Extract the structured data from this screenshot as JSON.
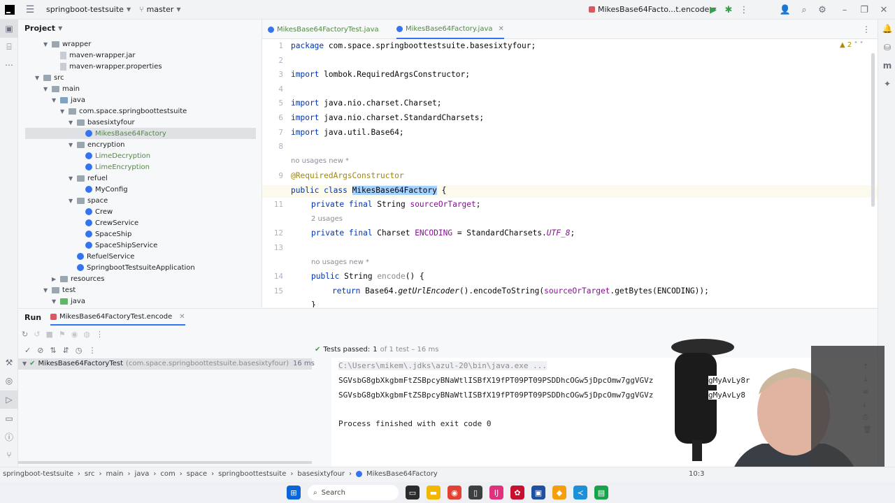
{
  "titlebar": {
    "project_name": "springboot-testsuite",
    "branch": "master",
    "run_config": "MikesBase64Facto...t.encode"
  },
  "project_panel": {
    "title": "Project",
    "items": [
      {
        "label": "wrapper",
        "kind": "folder"
      },
      {
        "label": "maven-wrapper.jar",
        "kind": "file"
      },
      {
        "label": "maven-wrapper.properties",
        "kind": "file"
      },
      {
        "label": "src",
        "kind": "folder"
      },
      {
        "label": "main",
        "kind": "folder"
      },
      {
        "label": "java",
        "kind": "folder"
      },
      {
        "label": "com.space.springboottestsuite",
        "kind": "package"
      },
      {
        "label": "basesixtyfour",
        "kind": "package"
      },
      {
        "label": "MikesBase64Factory",
        "kind": "class"
      },
      {
        "label": "encryption",
        "kind": "package"
      },
      {
        "label": "LimeDecryption",
        "kind": "class"
      },
      {
        "label": "LimeEncryption",
        "kind": "class"
      },
      {
        "label": "refuel",
        "kind": "package"
      },
      {
        "label": "MyConfig",
        "kind": "class"
      },
      {
        "label": "space",
        "kind": "package"
      },
      {
        "label": "Crew",
        "kind": "class"
      },
      {
        "label": "CrewService",
        "kind": "class"
      },
      {
        "label": "SpaceShip",
        "kind": "class"
      },
      {
        "label": "SpaceShipService",
        "kind": "class"
      },
      {
        "label": "RefuelService",
        "kind": "class"
      },
      {
        "label": "SpringbootTestsuiteApplication",
        "kind": "class"
      },
      {
        "label": "resources",
        "kind": "folder"
      },
      {
        "label": "test",
        "kind": "folder"
      },
      {
        "label": "java",
        "kind": "folder"
      }
    ]
  },
  "tabs": [
    {
      "label": "MikesBase64FactoryTest.java"
    },
    {
      "label": "MikesBase64Factory.java"
    }
  ],
  "editor": {
    "warnings": "2",
    "line_numbers": [
      "1",
      "2",
      "3",
      "4",
      "5",
      "6",
      "7",
      "8",
      "9",
      "10",
      "11",
      "12",
      "13",
      "14",
      "15"
    ],
    "line1_pkg": "package",
    "line1_name": " com.space.springboottestsuite.basesixtyfour;",
    "line3_import": "import",
    "line3_name": " lombok.RequiredArgsConstructor;",
    "line5": " java.nio.charset.Charset;",
    "line6": " java.nio.charset.StandardCharsets;",
    "line7": " java.util.Base64;",
    "hint_class": "no usages  new *",
    "annotation": "@RequiredArgsConstructor",
    "class_kw": "public class",
    "class_name": "MikesBase64Factory",
    "class_brace": " {",
    "l11_kw": "private final",
    "l11_type": " String ",
    "l11_field": "sourceOrTarget",
    "l11_end": ";",
    "hint_field": "2 usages",
    "l12_type": " Charset ",
    "l12_field": "ENCODING",
    "l12_mid": " = StandardCharsets.",
    "l12_const": "UTF_8",
    "hint_method": "no usages  new *",
    "l14_kw": "public",
    "l14_type": " String ",
    "l14_name": "encode",
    "l14_end": "() {",
    "l15_return": "return",
    "l15_a": " Base64.",
    "l15_b": "getUrlEncoder",
    "l15_c": "().encodeToString(",
    "l15_d": "sourceOrTarget",
    "l15_e": ".getBytes(ENCODING));",
    "l16": "}"
  },
  "run": {
    "title": "Run",
    "config_tab": "MikesBase64FactoryTest.encode",
    "tests_passed_label": "Tests passed:",
    "tests_passed_count": "1",
    "tests_passed_rest": "of 1 test – 16 ms",
    "test_name": "MikesBase64FactoryTest",
    "test_package": "(com.space.springboottestsuite.basesixtyfour)",
    "test_time": "16 ms",
    "console_cmd": "C:\\Users\\mikem\\.jdks\\azul-20\\bin\\java.exe ...",
    "console_line1": "SGVsbG8gbXkgbmFtZSBpcyBNaWtlISBfX19fPT09PT09PSDDhcOGw5jDpcOmw7ggVGVz",
    "console_line2": "SGVsbG8gbXkgbmFtZSBpcyBNaWtlISBfX19fPT09PT09PSDDhcOGw5jDpcOmw7ggVGVz",
    "console_tail1": "gMyAvLy8r",
    "console_tail2": "gMyAvLy8",
    "exit": "Process finished with exit code 0"
  },
  "statusbar": {
    "crumbs": [
      "springboot-testsuite",
      "src",
      "main",
      "java",
      "com",
      "space",
      "springboottestsuite",
      "basesixtyfour",
      "MikesBase64Factory"
    ],
    "time": "10:3"
  },
  "taskbar": {
    "search": "Search"
  }
}
